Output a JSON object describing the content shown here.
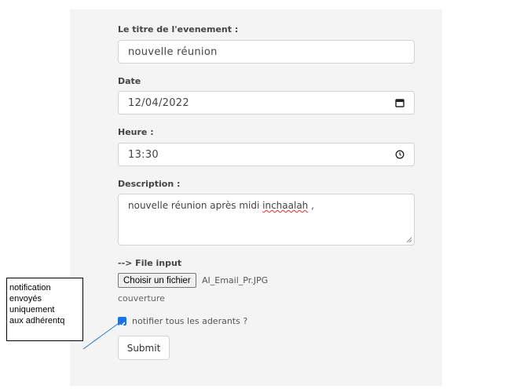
{
  "form": {
    "title_label": "Le titre de l'evenement :",
    "title_value": "nouvelle réunion",
    "date_label": "Date",
    "date_value": "12/04/2022",
    "time_label": "Heure :",
    "time_value": "13:30",
    "description_label": "Description :",
    "description_value_prefix": "nouvelle réunion après midi ",
    "description_value_misspelled": "inchaalah",
    "description_value_suffix": " ,",
    "file_label": "--> File input",
    "file_button": "Choisir un fichier",
    "file_name": "AI_Email_Pr.JPG",
    "cover_label": "couverture",
    "notify_label": "notifier tous les aderants ?",
    "notify_checked": true,
    "submit_label": "Submit"
  },
  "annotation": {
    "lines": [
      "notification",
      "envoyés",
      "uniquement",
      "aux adhérentq"
    ]
  },
  "colors": {
    "panel_bg": "#f4f4f4",
    "checkbox": "#1a73e8",
    "connector": "#2e75b6"
  },
  "icons": {
    "date": "calendar-icon",
    "time": "clock-icon"
  }
}
